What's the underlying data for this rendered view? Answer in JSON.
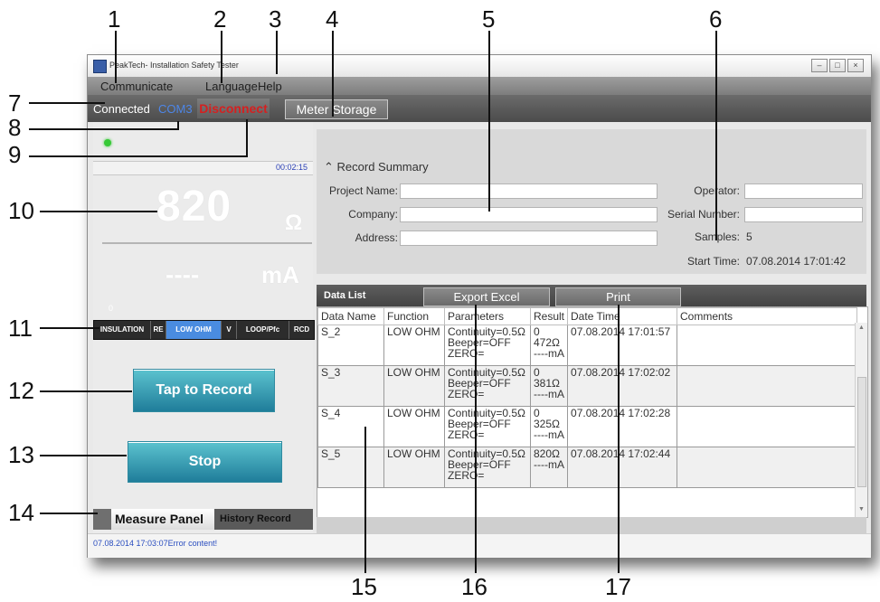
{
  "window": {
    "title": "PeakTech- Installation Safety Tester",
    "controls": [
      "minimize-icon",
      "restore-icon",
      "close-icon"
    ]
  },
  "menu": {
    "items": [
      "Communicate",
      "Language",
      "Help"
    ]
  },
  "connection": {
    "status": "Connected",
    "port": "COM3",
    "disconnect_label": "Disconnect",
    "meter_storage_label": "Meter Storage"
  },
  "meter": {
    "timer": "00:02:15",
    "main_value": "820",
    "main_unit": "Ω",
    "secondary_value": "----",
    "secondary_unit": "mA",
    "zero_marker": "0",
    "modes": [
      "INSULATION",
      "RE",
      "LOW OHM",
      "V",
      "LOOP/Pfc",
      "RCD"
    ],
    "active_mode": "LOW OHM",
    "led_color": "#36c936"
  },
  "buttons": {
    "record": "Tap to Record",
    "stop": "Stop"
  },
  "panel_tabs": {
    "measure": "Measure Panel",
    "history": "History Record"
  },
  "status_message": "07.08.2014 17:03:07Error content!",
  "record_summary": {
    "heading": "Record Summary",
    "project_label": "Project Name:",
    "company_label": "Company:",
    "address_label": "Address:",
    "operator_label": "Operator:",
    "serial_label": "Serial Number:",
    "samples_label": "Samples:",
    "samples_value": "5",
    "start_label": "Start Time:",
    "start_value": "07.08.2014 17:01:42",
    "project_value": "",
    "company_value": "",
    "address_value": "",
    "operator_value": "",
    "serial_value": ""
  },
  "data_list": {
    "label": "Data List",
    "export_label": "Export Excel",
    "print_label": "Print",
    "columns": [
      "Data Name",
      "Function",
      "Parameters",
      "Result",
      "Date Time",
      "Comments"
    ],
    "rows": [
      {
        "name": "S_2",
        "function": "LOW OHM",
        "params": [
          "Continuity=0.5Ω",
          "Beeper=OFF",
          "ZERO="
        ],
        "result": [
          "0",
          "472Ω",
          "----mA"
        ],
        "datetime": "07.08.2014 17:01:57",
        "comments": ""
      },
      {
        "name": "S_3",
        "function": "LOW OHM",
        "params": [
          "Continuity=0.5Ω",
          "Beeper=OFF",
          "ZERO="
        ],
        "result": [
          "0",
          "381Ω",
          "----mA"
        ],
        "datetime": "07.08.2014 17:02:02",
        "comments": ""
      },
      {
        "name": "S_4",
        "function": "LOW OHM",
        "params": [
          "Continuity=0.5Ω",
          "Beeper=OFF",
          "ZERO="
        ],
        "result": [
          "0",
          "325Ω",
          "----mA"
        ],
        "datetime": "07.08.2014 17:02:28",
        "comments": ""
      },
      {
        "name": "S_5",
        "function": "LOW OHM",
        "params": [
          "Continuity=0.5Ω",
          "Beeper=OFF",
          "ZERO="
        ],
        "result": [
          "820Ω",
          "----mA"
        ],
        "datetime": "07.08.2014 17:02:44",
        "comments": ""
      }
    ]
  },
  "callouts": [
    "1",
    "2",
    "3",
    "4",
    "5",
    "6",
    "7",
    "8",
    "9",
    "10",
    "11",
    "12",
    "13",
    "14",
    "15",
    "16",
    "17"
  ]
}
